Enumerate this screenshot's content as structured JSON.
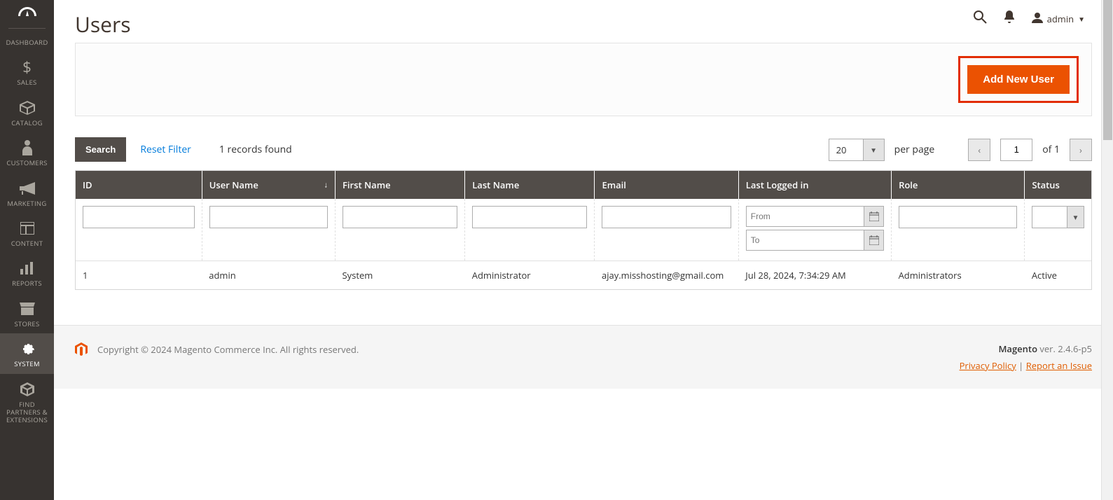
{
  "sidebar": {
    "items": [
      {
        "label": "DASHBOARD"
      },
      {
        "label": "SALES"
      },
      {
        "label": "CATALOG"
      },
      {
        "label": "CUSTOMERS"
      },
      {
        "label": "MARKETING"
      },
      {
        "label": "CONTENT"
      },
      {
        "label": "REPORTS"
      },
      {
        "label": "STORES"
      },
      {
        "label": "SYSTEM"
      },
      {
        "label": "FIND PARTNERS & EXTENSIONS"
      }
    ]
  },
  "header": {
    "title": "Users",
    "account_label": "admin"
  },
  "actions": {
    "add_user": "Add New User"
  },
  "toolbar": {
    "search": "Search",
    "reset": "Reset Filter",
    "records_found": "1 records found",
    "per_page_value": "20",
    "per_page_label": "per page",
    "page_value": "1",
    "page_of": "of 1"
  },
  "columns": {
    "id": "ID",
    "username": "User Name",
    "first": "First Name",
    "last": "Last Name",
    "email": "Email",
    "logged": "Last Logged in",
    "role": "Role",
    "status": "Status"
  },
  "filters": {
    "date_from_placeholder": "From",
    "date_to_placeholder": "To"
  },
  "rows": [
    {
      "id": "1",
      "username": "admin",
      "first": "System",
      "last": "Administrator",
      "email": "ajay.misshosting@gmail.com",
      "logged": "Jul 28, 2024, 7:34:29 AM",
      "role": "Administrators",
      "status": "Active"
    }
  ],
  "footer": {
    "copyright": "Copyright © 2024 Magento Commerce Inc. All rights reserved.",
    "product": "Magento",
    "version": " ver. 2.4.6-p5",
    "privacy": "Privacy Policy",
    "report": "Report an Issue",
    "sep": " | "
  }
}
